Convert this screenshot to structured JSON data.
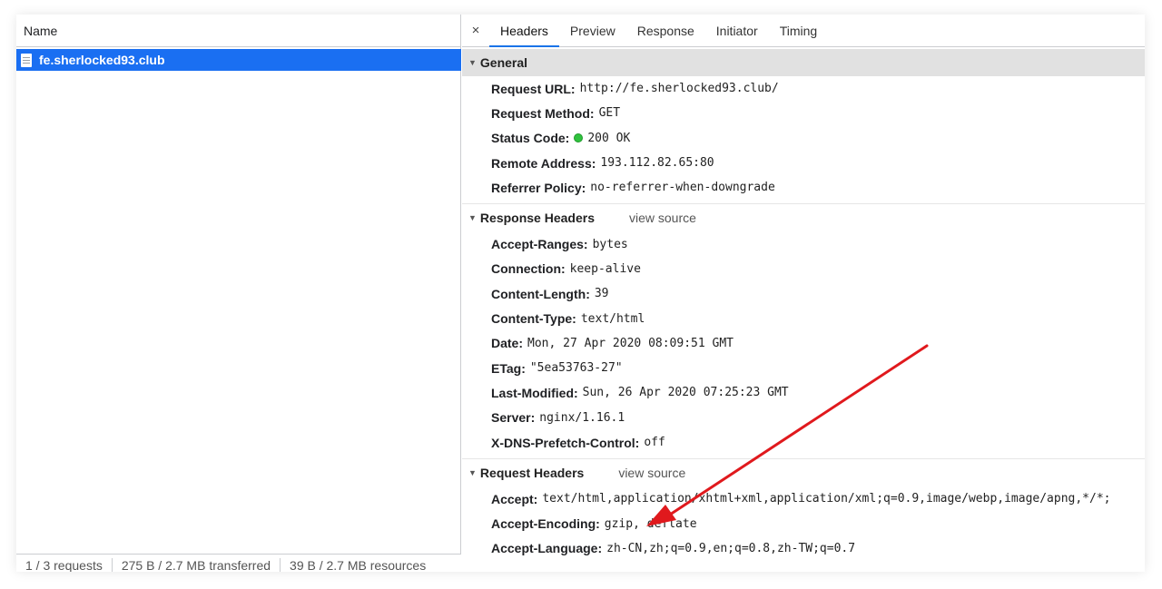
{
  "left": {
    "column_header": "Name",
    "request_name": "fe.sherlocked93.club",
    "status": {
      "requests": "1 / 3 requests",
      "transferred": "275 B / 2.7 MB transferred",
      "resources": "39 B / 2.7 MB resources"
    }
  },
  "tabs": {
    "close": "×",
    "items": [
      "Headers",
      "Preview",
      "Response",
      "Initiator",
      "Timing"
    ],
    "active": "Headers"
  },
  "general": {
    "title": "General",
    "rows": [
      {
        "key": "Request URL:",
        "value": "http://fe.sherlocked93.club/"
      },
      {
        "key": "Request Method:",
        "value": "GET"
      },
      {
        "key": "Status Code:",
        "value": "200 OK"
      },
      {
        "key": "Remote Address:",
        "value": "193.112.82.65:80"
      },
      {
        "key": "Referrer Policy:",
        "value": "no-referrer-when-downgrade"
      }
    ]
  },
  "response_headers": {
    "title": "Response Headers",
    "view_source": "view source",
    "rows": [
      {
        "key": "Accept-Ranges:",
        "value": "bytes"
      },
      {
        "key": "Connection:",
        "value": "keep-alive"
      },
      {
        "key": "Content-Length:",
        "value": "39"
      },
      {
        "key": "Content-Type:",
        "value": "text/html"
      },
      {
        "key": "Date:",
        "value": "Mon, 27 Apr 2020 08:09:51 GMT"
      },
      {
        "key": "ETag:",
        "value": "\"5ea53763-27\""
      },
      {
        "key": "Last-Modified:",
        "value": "Sun, 26 Apr 2020 07:25:23 GMT"
      },
      {
        "key": "Server:",
        "value": "nginx/1.16.1"
      },
      {
        "key": "X-DNS-Prefetch-Control:",
        "value": "off"
      }
    ]
  },
  "request_headers": {
    "title": "Request Headers",
    "view_source": "view source",
    "rows": [
      {
        "key": "Accept:",
        "value": "text/html,application/xhtml+xml,application/xml;q=0.9,image/webp,image/apng,*/*;"
      },
      {
        "key": "Accept-Encoding:",
        "value": "gzip, deflate"
      },
      {
        "key": "Accept-Language:",
        "value": "zh-CN,zh;q=0.9,en;q=0.8,zh-TW;q=0.7"
      }
    ]
  },
  "colors": {
    "selection": "#1a6ff2",
    "active_tab_underline": "#1a73e8",
    "status_ok_dot": "#30c23e",
    "annotation_arrow": "#e0191d"
  }
}
